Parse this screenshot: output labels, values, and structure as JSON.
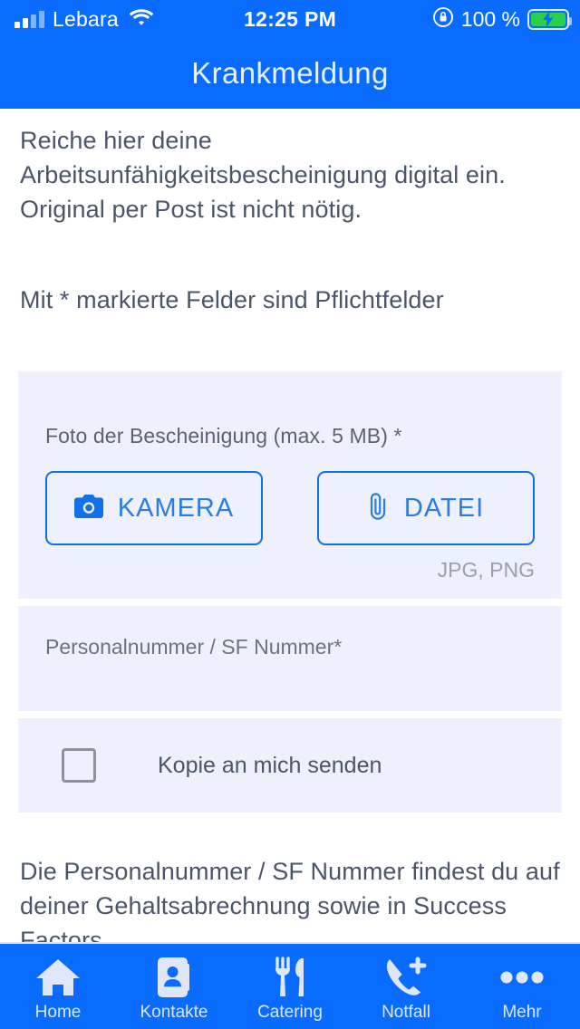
{
  "status_bar": {
    "carrier": "Lebara",
    "time": "12:25 PM",
    "battery_percent": "100 %",
    "signal_icon": "signal-bars-icon",
    "wifi_icon": "wifi-icon",
    "rotation_lock_icon": "rotation-lock-icon",
    "battery_icon": "battery-charging-icon"
  },
  "header": {
    "title": "Krankmeldung"
  },
  "main": {
    "intro_text": "Reiche hier deine Arbeitsunfähigkeitsbescheinigung digital ein. Original per Post ist nicht nötig.",
    "required_note": "Mit * markierte Felder sind Pflichtfelder",
    "photo_card": {
      "label": "Foto der Bescheinigung (max. 5 MB) *",
      "camera_button": "KAMERA",
      "camera_icon": "camera-icon",
      "file_button": "DATEI",
      "file_icon": "paperclip-icon",
      "formats_hint": "JPG, PNG"
    },
    "personnel_field": {
      "placeholder": "Personalnummer / SF Nummer*",
      "value": ""
    },
    "copy_checkbox": {
      "label": "Kopie an mich senden",
      "checked": false
    },
    "footer_note": "Die Personalnummer / SF Nummer findest du auf deiner Gehaltsabrechnung sowie in Success Factors."
  },
  "tabbar": {
    "items": [
      {
        "label": "Home",
        "icon": "home-icon"
      },
      {
        "label": "Kontakte",
        "icon": "contacts-card-icon"
      },
      {
        "label": "Catering",
        "icon": "fork-knife-icon"
      },
      {
        "label": "Notfall",
        "icon": "phone-plus-icon"
      },
      {
        "label": "Mehr",
        "icon": "ellipsis-icon"
      }
    ]
  },
  "colors": {
    "brand_blue": "#0a6cff",
    "card_bg": "#eef0fb",
    "outline_blue": "#1171e8",
    "text_gray": "#4a5568",
    "hint_gray": "#9aa0ad"
  }
}
